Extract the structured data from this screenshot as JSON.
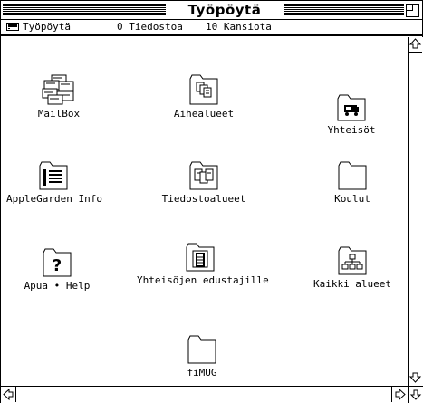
{
  "window": {
    "title": "Työpöytä"
  },
  "infobar": {
    "disk_name": "Työpöytä",
    "files": "0 Tiedostoa",
    "folders": "10 Kansiota"
  },
  "items": [
    {
      "label": "MailBox",
      "icon": "mailbox-icon"
    },
    {
      "label": "Aihealueet",
      "icon": "folder-documents-icon"
    },
    {
      "label": "Yhteisöt",
      "icon": "folder-truck-icon"
    },
    {
      "label": "AppleGarden Info",
      "icon": "folder-list-icon"
    },
    {
      "label": "Tiedostoalueet",
      "icon": "folder-files-icon"
    },
    {
      "label": "Koulut",
      "icon": "folder-icon"
    },
    {
      "label": "Apua • Help",
      "icon": "folder-question-icon"
    },
    {
      "label": "Yhteisöjen edustajille",
      "icon": "folder-building-icon"
    },
    {
      "label": "Kaikki alueet",
      "icon": "folder-network-icon"
    },
    {
      "label": "fiMUG",
      "icon": "folder-icon"
    }
  ]
}
